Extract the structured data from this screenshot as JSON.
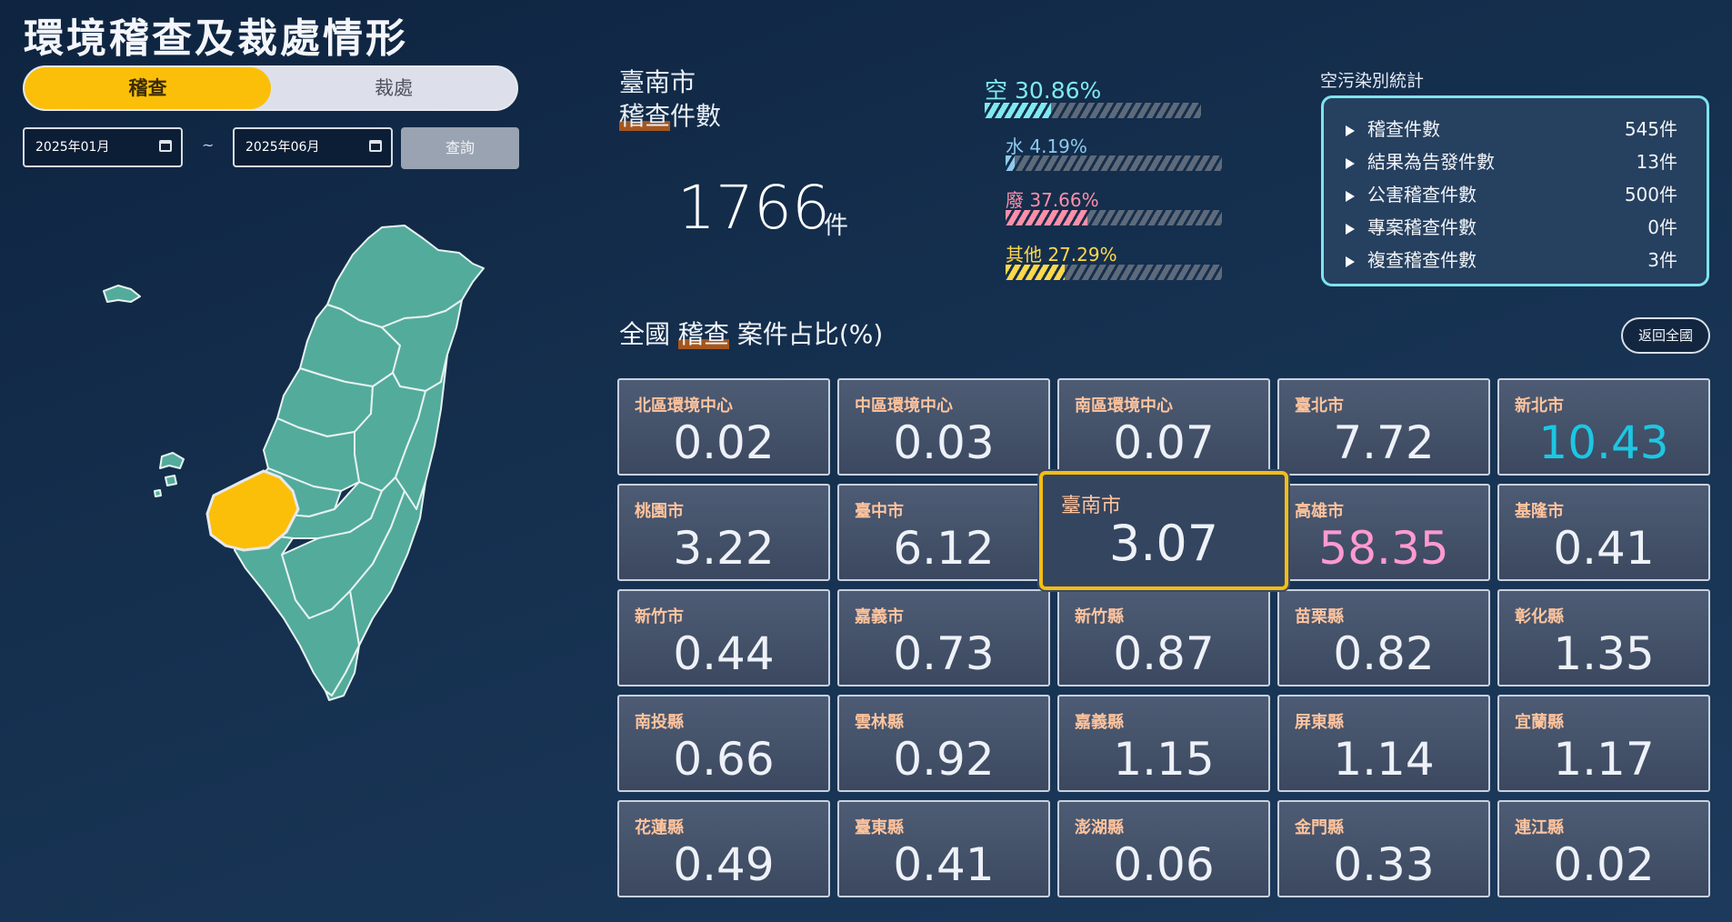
{
  "title": "環境稽查及裁處情形",
  "toggle": {
    "active_label": "稽查",
    "inactive_label": "裁處"
  },
  "filters": {
    "start_date": "2025年01月",
    "end_date": "2025年06月",
    "separator": "~",
    "query_label": "查詢"
  },
  "summary": {
    "city": "臺南市",
    "label_hl": "稽查",
    "label_rest": "件數",
    "count": "1766",
    "unit": "件"
  },
  "pollution_bars": [
    {
      "label": "空 30.86%",
      "percent": 30.86,
      "color": "#7fe9ef"
    },
    {
      "label": "水 4.19%",
      "percent": 4.19,
      "color": "#8ec9ec"
    },
    {
      "label": "廢 37.66%",
      "percent": 37.66,
      "color": "#ff8fa8"
    },
    {
      "label": "其他 27.29%",
      "percent": 27.29,
      "color": "#ffd84a"
    }
  ],
  "air_stats": {
    "title": "空污染別統計",
    "rows": [
      {
        "label": "稽查件數",
        "value": "545件"
      },
      {
        "label": "結果為告發件數",
        "value": "13件"
      },
      {
        "label": "公害稽查件數",
        "value": "500件"
      },
      {
        "label": "專案稽查件數",
        "value": "0件"
      },
      {
        "label": "複查稽查件數",
        "value": "3件"
      }
    ]
  },
  "national": {
    "title_pre": "全國",
    "title_hl": "稽查",
    "title_post": "案件占比(%)",
    "back_label": "返回全國"
  },
  "cells": [
    {
      "name": "北區環境中心",
      "value": "0.02"
    },
    {
      "name": "中區環境中心",
      "value": "0.03"
    },
    {
      "name": "南區環境中心",
      "value": "0.07"
    },
    {
      "name": "臺北市",
      "value": "7.72"
    },
    {
      "name": "新北市",
      "value": "10.43"
    },
    {
      "name": "桃園市",
      "value": "3.22"
    },
    {
      "name": "臺中市",
      "value": "6.12"
    },
    {
      "name": "臺南市",
      "value": "3.07"
    },
    {
      "name": "高雄市",
      "value": "58.35"
    },
    {
      "name": "基隆市",
      "value": "0.41"
    },
    {
      "name": "新竹市",
      "value": "0.44"
    },
    {
      "name": "嘉義市",
      "value": "0.73"
    },
    {
      "name": "新竹縣",
      "value": "0.87"
    },
    {
      "name": "苗栗縣",
      "value": "0.82"
    },
    {
      "name": "彰化縣",
      "value": "1.35"
    },
    {
      "name": "南投縣",
      "value": "0.66"
    },
    {
      "name": "雲林縣",
      "value": "0.92"
    },
    {
      "name": "嘉義縣",
      "value": "1.15"
    },
    {
      "name": "屏東縣",
      "value": "1.14"
    },
    {
      "name": "宜蘭縣",
      "value": "1.17"
    },
    {
      "name": "花蓮縣",
      "value": "0.49"
    },
    {
      "name": "臺東縣",
      "value": "0.41"
    },
    {
      "name": "澎湖縣",
      "value": "0.06"
    },
    {
      "name": "金門縣",
      "value": "0.33"
    },
    {
      "name": "連江縣",
      "value": "0.02"
    }
  ],
  "colors": {
    "accent": "#fbbf0a",
    "map_fill": "#53ab9c",
    "highlight_value_blue": "#1cc7e3",
    "highlight_value_pink": "#ff9ad0"
  }
}
